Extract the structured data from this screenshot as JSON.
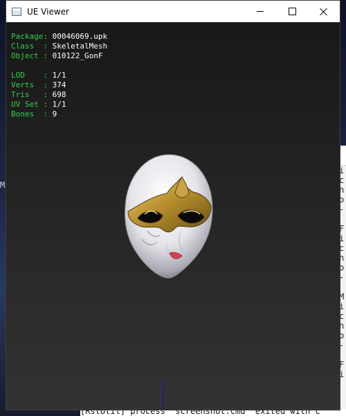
{
  "window": {
    "title": "UE Viewer"
  },
  "info": {
    "package_label": "Package:",
    "package_value": "00046069.upk",
    "class_label": "Class  :",
    "class_value": "SkeletalMesh",
    "object_label": "Object :",
    "object_value": "010122_GonF",
    "lod_label": "LOD    :",
    "lod_value": "1/1",
    "verts_label": "Verts  :",
    "verts_value": "374",
    "tris_label": "Tris   :",
    "tris_value": "698",
    "uvset_label": "UV Set :",
    "uvset_value": "1/1",
    "bones_label": "Bones  :",
    "bones_value": "9"
  },
  "console": {
    "lines": [
      "i",
      "c",
      "h",
      "o",
      "-",
      "F",
      "i",
      "c",
      "h",
      "o",
      "-",
      "M",
      "i",
      "c",
      "h",
      "o",
      "-",
      "F",
      "i"
    ]
  },
  "background_fragment": "M",
  "bottom_text": "[RstUtil] process \"screenshot.cmd\" exited with c",
  "colors": {
    "label_green": "#2fd14a",
    "value_white": "#ffffff",
    "mask_gold": "#b8902e",
    "mask_white": "#e8e8ec"
  }
}
